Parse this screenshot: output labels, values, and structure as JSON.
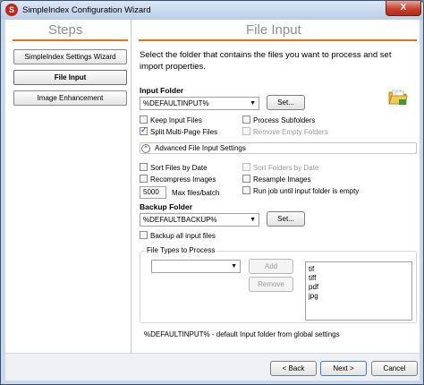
{
  "window": {
    "title": "SimpleIndex Configuration Wizard",
    "close_glyph": "X"
  },
  "colors": {
    "accent_rule": "#e7721c",
    "titlebar": "#c9d8ea",
    "close": "#c9432c"
  },
  "steps": {
    "title": "Steps",
    "items": [
      {
        "label": "SimpleIndex Settings Wizard",
        "active": false
      },
      {
        "label": "File Input",
        "active": true
      },
      {
        "label": "Image Enhancement",
        "active": false
      }
    ]
  },
  "main": {
    "title": "File Input",
    "description": "Select the folder that contains the files you want to process and set import properties."
  },
  "input_folder": {
    "label": "Input Folder",
    "value": "%DEFAULTINPUT%",
    "set_label": "Set...",
    "icon": "folder-open-icon"
  },
  "input_options": {
    "keep_input": {
      "label": "Keep Input Files",
      "checked": false
    },
    "process_sub": {
      "label": "Process Subfolders",
      "checked": false
    },
    "split_multi": {
      "label": "Split Multi-Page Files",
      "checked": true
    },
    "remove_empty": {
      "label": "Remove Empty Folders",
      "checked": false,
      "disabled": true
    }
  },
  "advanced": {
    "label": "Advanced File Input Settings",
    "toggle_glyph": "^",
    "sort_by_date": {
      "label": "Sort Files by Date",
      "checked": false
    },
    "sort_folders": {
      "label": "Sort Folders by Date",
      "checked": false,
      "disabled": true
    },
    "recompress": {
      "label": "Recompress Images",
      "checked": false
    },
    "resample": {
      "label": "Resample Images",
      "checked": false
    },
    "max_files": {
      "value": "5000",
      "label": "Max files/batch"
    },
    "run_until_empty": {
      "label": "Run job until input folder is empty",
      "checked": false
    }
  },
  "backup_folder": {
    "label": "Backup Folder",
    "value": "%DEFAULTBACKUP%",
    "set_label": "Set...",
    "backup_all": {
      "label": "Backup all input files",
      "checked": false
    }
  },
  "file_types": {
    "legend": "File Types to Process",
    "add_label": "Add",
    "remove_label": "Remove",
    "items": [
      "tif",
      "tiff",
      "pdf",
      "jpg"
    ]
  },
  "footnote": "%DEFAULTINPUT% - default Input folder from global settings",
  "nav": {
    "back_label": "< Back",
    "next_label": "Next >",
    "cancel_label": "Cancel"
  }
}
